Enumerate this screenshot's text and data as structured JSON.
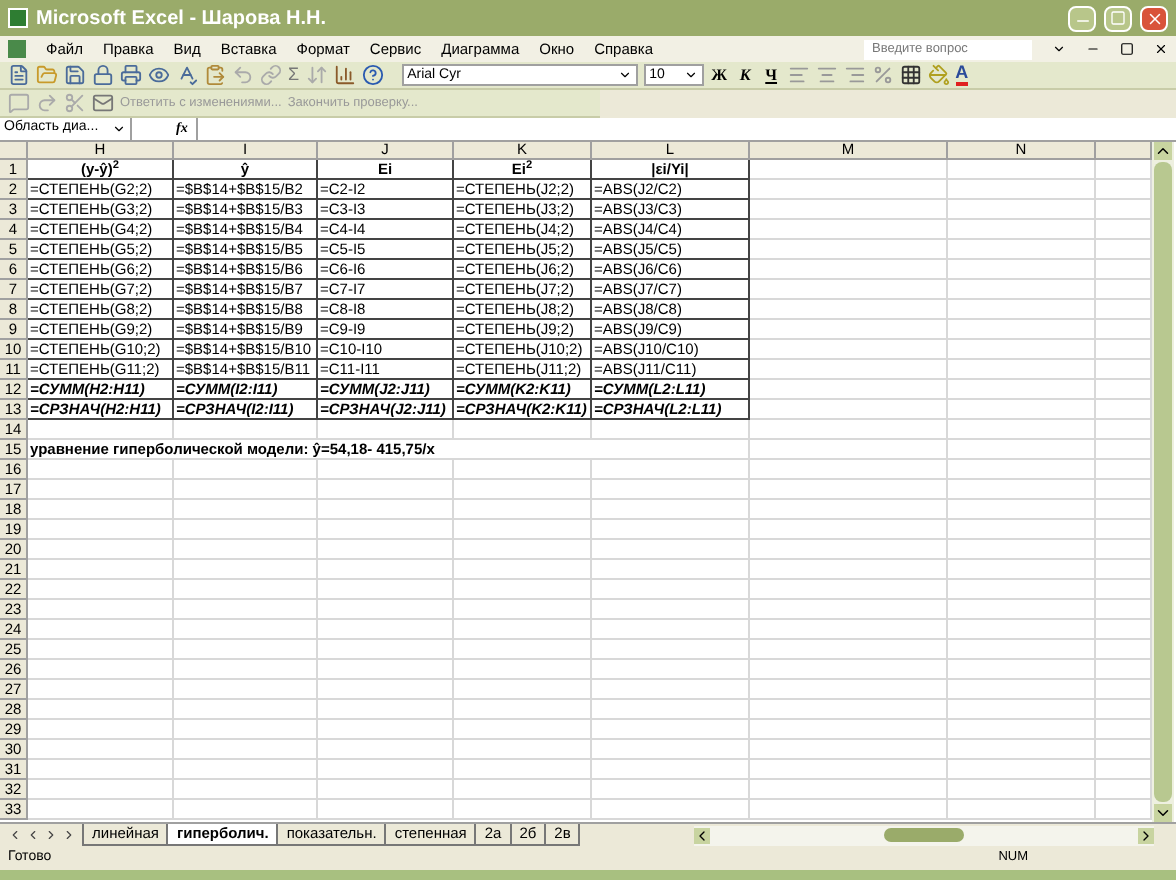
{
  "window": {
    "title": "Microsoft Excel - Шарова Н.Н."
  },
  "menu": [
    "Файл",
    "Правка",
    "Вид",
    "Вставка",
    "Формат",
    "Сервис",
    "Диаграмма",
    "Окно",
    "Справка"
  ],
  "help_field": {
    "placeholder": "Введите вопрос"
  },
  "toolbar": {
    "sum": "Σ",
    "font": "Arial Cyr",
    "size": "10",
    "format_buttons": [
      "Ж",
      "К",
      "Ч"
    ],
    "font_color": "A"
  },
  "review_toolbar": {
    "reply": "Ответить с изменениями...",
    "finish": "Закончить проверку..."
  },
  "formula_bar": {
    "name_box": "Область диа...",
    "fx": "fx"
  },
  "columns": [
    "H",
    "I",
    "J",
    "K",
    "L",
    "M",
    "N"
  ],
  "rows": [
    {
      "number": "1",
      "kind": "header",
      "cells": [
        "(y-ŷ)$^{2}$",
        "ŷ",
        "Ei",
        "Ei$^{2}$",
        "|εi/Yi|"
      ]
    },
    {
      "number": "2",
      "kind": "formula",
      "cells": [
        "=СТЕПЕНЬ(G2;2)",
        "=$B$14+$B$15/B2",
        "=C2-I2",
        "=СТЕПЕНЬ(J2;2)",
        "=ABS(J2/C2)"
      ]
    },
    {
      "number": "3",
      "kind": "formula",
      "cells": [
        "=СТЕПЕНЬ(G3;2)",
        "=$B$14+$B$15/B3",
        "=C3-I3",
        "=СТЕПЕНЬ(J3;2)",
        "=ABS(J3/C3)"
      ]
    },
    {
      "number": "4",
      "kind": "formula",
      "cells": [
        "=СТЕПЕНЬ(G4;2)",
        "=$B$14+$B$15/B4",
        "=C4-I4",
        "=СТЕПЕНЬ(J4;2)",
        "=ABS(J4/C4)"
      ]
    },
    {
      "number": "5",
      "kind": "formula",
      "cells": [
        "=СТЕПЕНЬ(G5;2)",
        "=$B$14+$B$15/B5",
        "=C5-I5",
        "=СТЕПЕНЬ(J5;2)",
        "=ABS(J5/C5)"
      ]
    },
    {
      "number": "6",
      "kind": "formula",
      "cells": [
        "=СТЕПЕНЬ(G6;2)",
        "=$B$14+$B$15/B6",
        "=C6-I6",
        "=СТЕПЕНЬ(J6;2)",
        "=ABS(J6/C6)"
      ]
    },
    {
      "number": "7",
      "kind": "formula",
      "cells": [
        "=СТЕПЕНЬ(G7;2)",
        "=$B$14+$B$15/B7",
        "=C7-I7",
        "=СТЕПЕНЬ(J7;2)",
        "=ABS(J7/C7)"
      ]
    },
    {
      "number": "8",
      "kind": "formula",
      "cells": [
        "=СТЕПЕНЬ(G8;2)",
        "=$B$14+$B$15/B8",
        "=C8-I8",
        "=СТЕПЕНЬ(J8;2)",
        "=ABS(J8/C8)"
      ]
    },
    {
      "number": "9",
      "kind": "formula",
      "cells": [
        "=СТЕПЕНЬ(G9;2)",
        "=$B$14+$B$15/B9",
        "=C9-I9",
        "=СТЕПЕНЬ(J9;2)",
        "=ABS(J9/C9)"
      ]
    },
    {
      "number": "10",
      "kind": "formula",
      "cells": [
        "=СТЕПЕНЬ(G10;2)",
        "=$B$14+$B$15/B10",
        "=C10-I10",
        "=СТЕПЕНЬ(J10;2)",
        "=ABS(J10/C10)"
      ]
    },
    {
      "number": "11",
      "kind": "formula",
      "cells": [
        "=СТЕПЕНЬ(G11;2)",
        "=$B$14+$B$15/B11",
        "=C11-I11",
        "=СТЕПЕНЬ(J11;2)",
        "=ABS(J11/C11)"
      ]
    },
    {
      "number": "12",
      "kind": "total",
      "cells": [
        "=СУММ(H2:H11)",
        "=СУММ(I2:I11)",
        "=СУММ(J2:J11)",
        "=СУММ(K2:K11)",
        "=СУММ(L2:L11)"
      ]
    },
    {
      "number": "13",
      "kind": "total",
      "cells": [
        "=СРЗНАЧ(H2:H11)",
        "=СРЗНАЧ(I2:I11)",
        "=СРЗНАЧ(J2:J11)",
        "=СРЗНАЧ(K2:K11)",
        "=СРЗНАЧ(L2:L11)"
      ]
    },
    {
      "number": "14",
      "kind": "empty"
    },
    {
      "number": "15",
      "kind": "note",
      "text": "уравнение гиперболической модели: ŷ=54,18- 415,75/x"
    },
    {
      "number": "16",
      "kind": "empty"
    },
    {
      "number": "17",
      "kind": "empty"
    },
    {
      "number": "18",
      "kind": "empty"
    },
    {
      "number": "19",
      "kind": "empty"
    },
    {
      "number": "20",
      "kind": "empty"
    },
    {
      "number": "21",
      "kind": "empty"
    },
    {
      "number": "22",
      "kind": "empty"
    },
    {
      "number": "23",
      "kind": "empty"
    },
    {
      "number": "24",
      "kind": "empty"
    },
    {
      "number": "25",
      "kind": "empty"
    },
    {
      "number": "26",
      "kind": "empty"
    },
    {
      "number": "27",
      "kind": "empty"
    },
    {
      "number": "28",
      "kind": "empty"
    },
    {
      "number": "29",
      "kind": "empty"
    },
    {
      "number": "30",
      "kind": "empty"
    },
    {
      "number": "31",
      "kind": "empty"
    },
    {
      "number": "32",
      "kind": "empty"
    },
    {
      "number": "33",
      "kind": "empty"
    }
  ],
  "sheet_tabs": [
    {
      "label": "линейная",
      "selected": false
    },
    {
      "label": "гиперболич.",
      "selected": true
    },
    {
      "label": "показательн.",
      "selected": false
    },
    {
      "label": "степенная",
      "selected": false
    },
    {
      "label": "2а",
      "selected": false
    },
    {
      "label": "2б",
      "selected": false
    },
    {
      "label": "2в",
      "selected": false
    }
  ],
  "status_bar": {
    "mode": "Готово",
    "num": "NUM"
  }
}
